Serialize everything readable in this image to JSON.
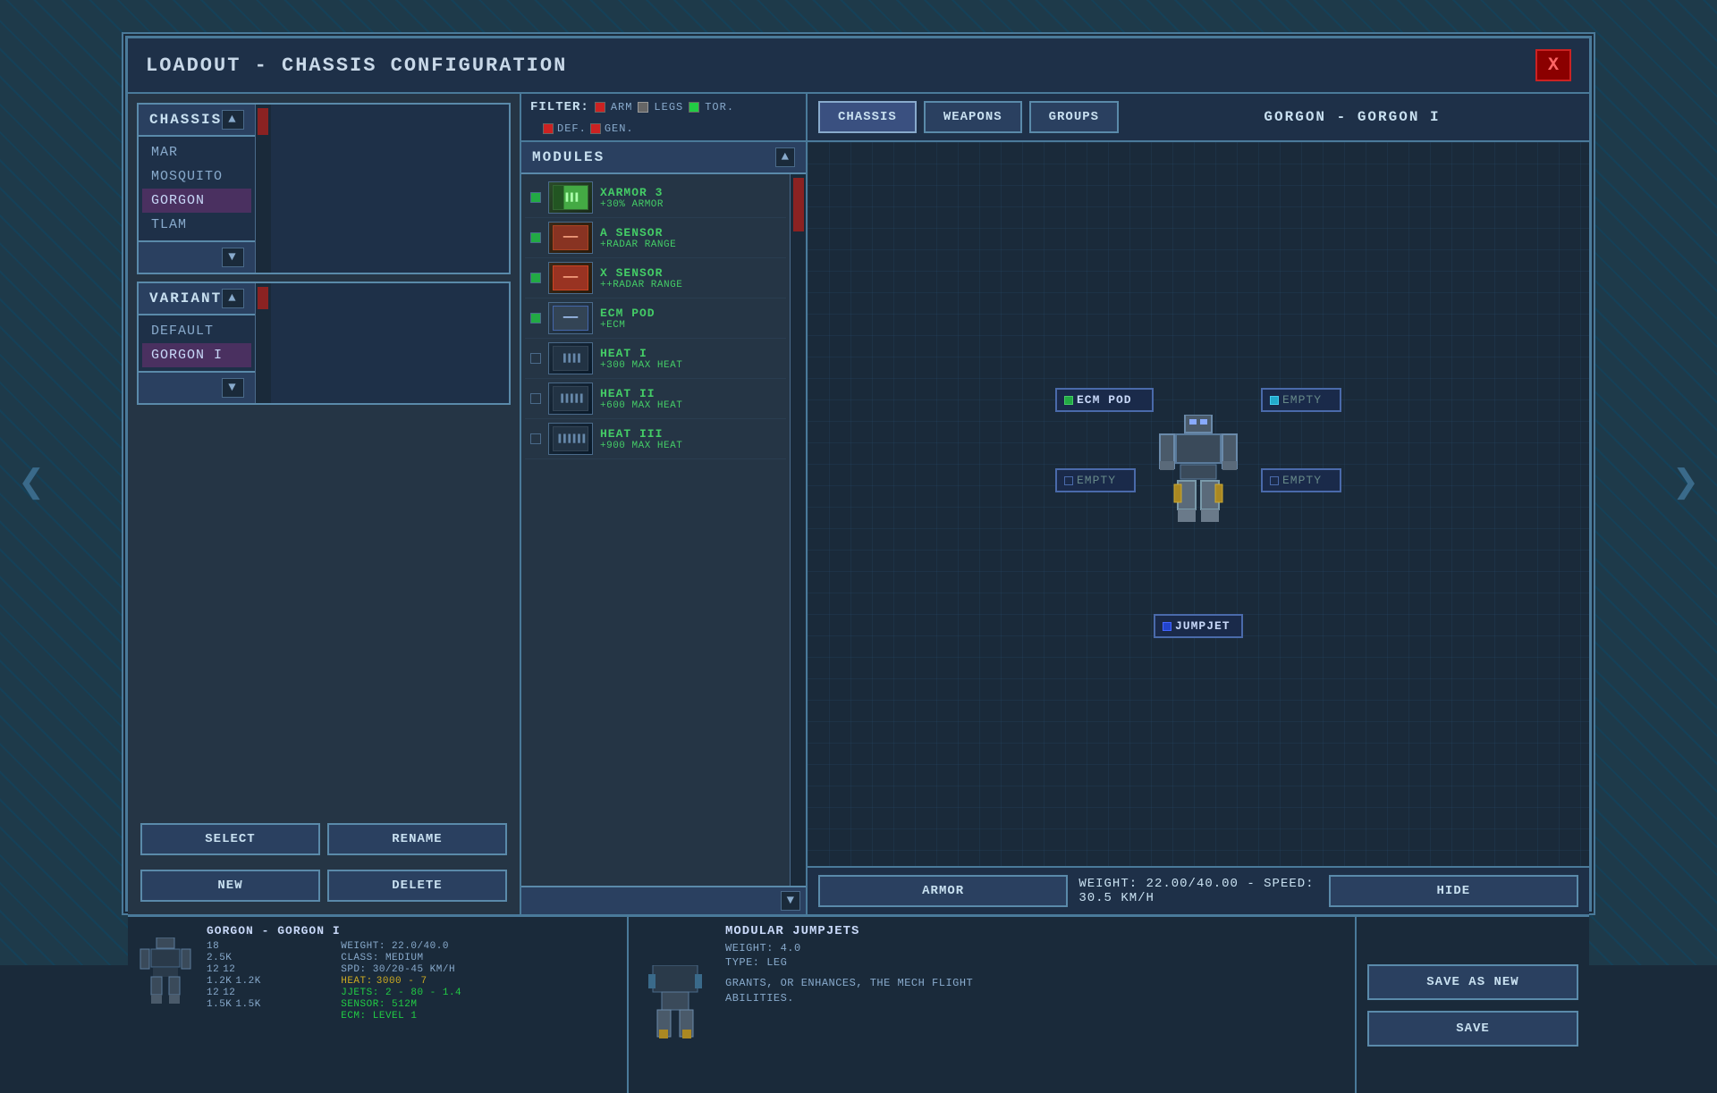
{
  "window": {
    "title": "LOADOUT - CHASSIS CONFIGURATION",
    "close_label": "X"
  },
  "tabs": {
    "chassis": "CHASSIS",
    "weapons": "WEAPONS",
    "groups": "GROUPS"
  },
  "chassis_section": {
    "label": "CHASSIS",
    "items": [
      {
        "id": "mar",
        "label": "MAR"
      },
      {
        "id": "mosquito",
        "label": "MOSQUITO"
      },
      {
        "id": "gorgon",
        "label": "GORGON",
        "selected": true
      },
      {
        "id": "tlam",
        "label": "TLAM"
      }
    ]
  },
  "variant_section": {
    "label": "VARIANT",
    "items": [
      {
        "id": "default",
        "label": "DEFAULT"
      },
      {
        "id": "gorgon1",
        "label": "GORGON I",
        "selected": true
      }
    ]
  },
  "buttons": {
    "select": "SELECT",
    "rename": "RENAME",
    "new": "NEW",
    "delete": "DELETE"
  },
  "filter": {
    "label": "FILTER:",
    "items": [
      {
        "color": "red",
        "label": "ARM"
      },
      {
        "color": "gray",
        "label": "LEGS"
      },
      {
        "color": "green",
        "label": "TOR."
      },
      {
        "color": "red",
        "label": "DEF."
      },
      {
        "color": "red",
        "label": "GEN."
      }
    ]
  },
  "modules": {
    "title": "MODULES",
    "items": [
      {
        "id": "xarmor3",
        "name": "XARMOR 3",
        "desc": "+30% ARMOR",
        "type": "armor",
        "checked": true
      },
      {
        "id": "a_sensor",
        "name": "A SENSOR",
        "desc": "+RADAR RANGE",
        "type": "sensor",
        "checked": true
      },
      {
        "id": "x_sensor",
        "name": "X SENSOR",
        "desc": "++RADAR RANGE",
        "type": "sensor",
        "checked": true
      },
      {
        "id": "ecm_pod",
        "name": "ECM POD",
        "desc": "+ECM",
        "type": "ecm",
        "checked": true
      },
      {
        "id": "heat1",
        "name": "HEAT I",
        "desc": "+300 MAX HEAT",
        "type": "heat",
        "checked": false
      },
      {
        "id": "heat2",
        "name": "HEAT II",
        "desc": "+600 MAX HEAT",
        "type": "heat",
        "checked": false
      },
      {
        "id": "heat3",
        "name": "HEAT III",
        "desc": "+900 MAX HEAT",
        "type": "heat",
        "checked": false
      }
    ]
  },
  "mech_display": {
    "title": "GORGON - GORGON I",
    "slots": {
      "ecm_pod": "ECM POD",
      "right_arm": "EMPTY",
      "left_torso": "EMPTY",
      "right_torso": "EMPTY",
      "jumpjet": "JUMPJET"
    },
    "armor_btn": "ARMOR",
    "hide_btn": "HIDE",
    "weight_info": "WEIGHT: 22.00/40.00 - SPEED: 30.5 KM/H"
  },
  "info_panel": {
    "mech_name": "GORGON - GORGON I",
    "stats": {
      "armor": "18",
      "weight": "WEIGHT: 22.0/40.0",
      "val1": "2.5K",
      "class": "CLASS:  MEDIUM",
      "val2a": "12",
      "val2b": "12",
      "spd": "SPD: 30/20-45 KM/H",
      "val3a": "1.2K",
      "val3b": "1.2K",
      "heat_label": "HEAT:",
      "heat_val": "3000 - 7",
      "val4a": "12",
      "val4b": "12",
      "jjets": "JJETS:  2 - 80 - 1.4",
      "val5a": "1.5K",
      "val5b": "1.5K",
      "sensor": "SENSOR: 512M",
      "ecm": "ECM:    LEVEL 1"
    },
    "selected_module": {
      "name": "MODULAR JUMPJETS",
      "weight": "WEIGHT: 4.0",
      "type": "TYPE:   LEG",
      "desc": "GRANTS, OR ENHANCES, THE MECH FLIGHT ABILITIES."
    }
  },
  "save_buttons": {
    "save_as_new": "SAVE AS NEW",
    "save": "SAVE"
  },
  "colors": {
    "accent": "#4a7a9a",
    "green_text": "#22cc44",
    "yellow_text": "#ccaa22",
    "panel_bg": "#1e3048",
    "text_primary": "#c8e0f0",
    "text_secondary": "#88aacc"
  }
}
